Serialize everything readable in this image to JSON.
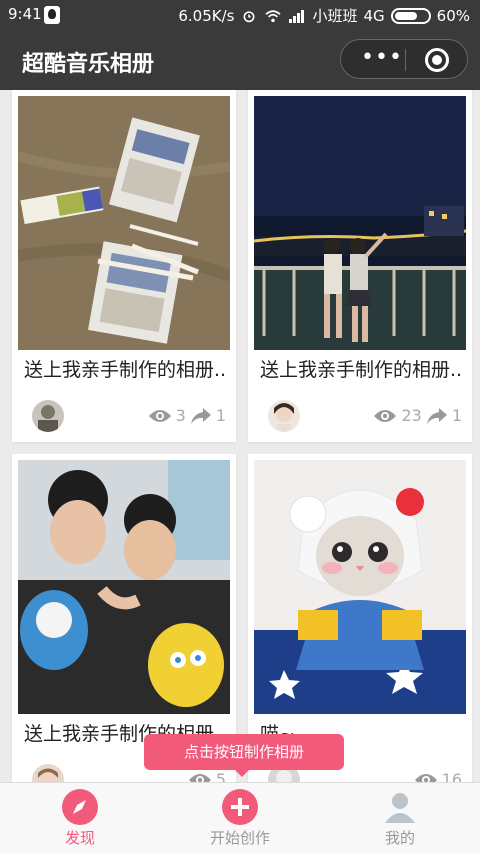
{
  "status_bar": {
    "time": "9:41",
    "network_speed": "6.05K/s",
    "carrier": "小班班",
    "network_type": "4G",
    "battery": "60%"
  },
  "nav": {
    "title": "超酷音乐相册",
    "more_label": "•••"
  },
  "cards": [
    {
      "title": "送上我亲手制作的相册..",
      "views": "3",
      "shares": "1"
    },
    {
      "title": "送上我亲手制作的相册..",
      "views": "23",
      "shares": "1"
    },
    {
      "title": "送上我亲手制作的相册..",
      "views": "5",
      "shares": ""
    },
    {
      "title": "喵~",
      "views": "16",
      "shares": ""
    }
  ],
  "tooltip": "点击按钮制作相册",
  "tabs": [
    {
      "label": "发现",
      "icon": "compass-icon",
      "active": true
    },
    {
      "label": "开始创作",
      "icon": "plus-icon",
      "active": false
    },
    {
      "label": "我的",
      "icon": "user-icon",
      "active": false
    }
  ],
  "colors": {
    "accent": "#f25a7a",
    "header_bg": "#3a3a3a",
    "inactive_tab": "#999999"
  }
}
